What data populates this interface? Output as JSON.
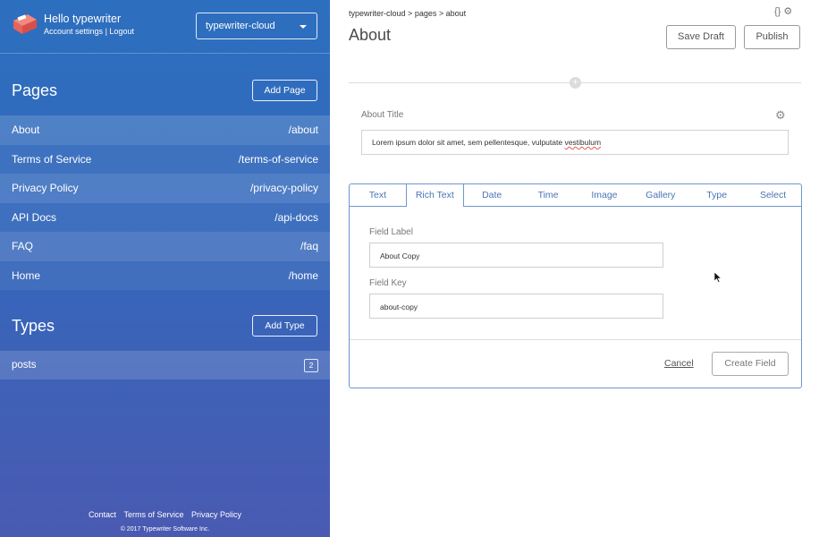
{
  "sidebar": {
    "greeting": "Hello typewriter",
    "account_settings": "Account settings",
    "separator": "|",
    "logout": "Logout",
    "site_selector": {
      "value": "typewriter-cloud"
    },
    "pages_section": {
      "title": "Pages",
      "add_button": "Add Page",
      "items": [
        {
          "name": "About",
          "path": "/about"
        },
        {
          "name": "Terms of Service",
          "path": "/terms-of-service"
        },
        {
          "name": "Privacy Policy",
          "path": "/privacy-policy"
        },
        {
          "name": "API Docs",
          "path": "/api-docs"
        },
        {
          "name": "FAQ",
          "path": "/faq"
        },
        {
          "name": "Home",
          "path": "/home"
        }
      ]
    },
    "types_section": {
      "title": "Types",
      "add_button": "Add Type",
      "items": [
        {
          "name": "posts",
          "count": "2"
        }
      ]
    },
    "footer": {
      "links": [
        "Contact",
        "Terms of Service",
        "Privacy Policy"
      ],
      "copyright": "© 2017 Typewriter Software Inc."
    }
  },
  "main": {
    "breadcrumb": {
      "site": "typewriter-cloud",
      "sep": ">",
      "section": "pages",
      "page": "about"
    },
    "top_icons": {
      "code": "{}",
      "settings": "⚙"
    },
    "title": "About",
    "save_draft": "Save Draft",
    "publish": "Publish",
    "add_symbol": "+",
    "title_field": {
      "label": "About Title",
      "value_start": "Lorem ipsum dolor sit amet, sem pellentesque, vulputate ",
      "value_misspelled": "vestibulum"
    },
    "field_editor": {
      "tabs": [
        "Text",
        "Rich Text",
        "Date",
        "Time",
        "Image",
        "Gallery",
        "Type",
        "Select"
      ],
      "active_tab": "Rich Text",
      "field_label": {
        "label": "Field Label",
        "value": "About Copy"
      },
      "field_key": {
        "label": "Field Key",
        "value": "about-copy"
      },
      "cancel": "Cancel",
      "create": "Create Field"
    }
  },
  "colors": {
    "sidebar_top": "#2d6fbf",
    "sidebar_bottom": "#4a5ab2",
    "accent": "#4a74b5",
    "logo": "#e8645a"
  },
  "icons": {
    "logo": "typewriter-logo",
    "select_caret": "chevron-down-icon",
    "code": "code-braces-icon",
    "settings": "gear-icon",
    "cursor": "mouse-pointer-icon"
  }
}
